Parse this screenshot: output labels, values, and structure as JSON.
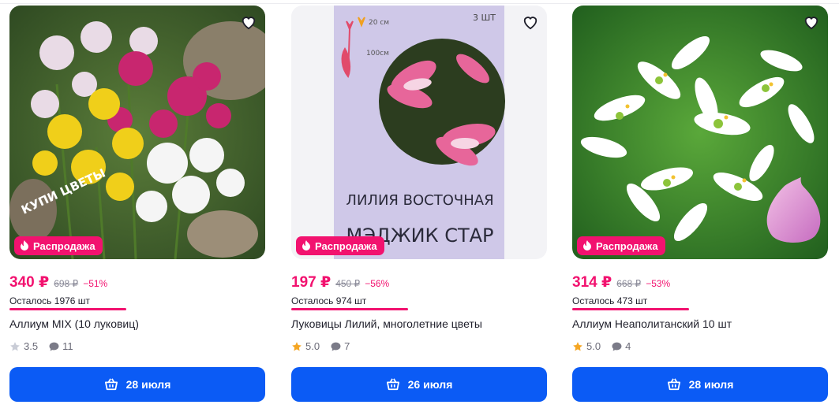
{
  "products": [
    {
      "badge": "Распродажа",
      "price": "340 ₽",
      "old_price": "698 ₽",
      "discount": "−51%",
      "stock_left": "Осталось 1976 шт",
      "title": "Аллиум MIX (10 луковиц)",
      "rating": "3.5",
      "reviews": "11",
      "delivery": "28 июля",
      "image_text": "КУПИ ЦВЕТЫ"
    },
    {
      "badge": "Распродажа",
      "price": "197 ₽",
      "old_price": "450 ₽",
      "discount": "−56%",
      "stock_left": "Осталось 974 шт",
      "title": "Луковицы Лилий, многолетние цветы",
      "rating": "5.0",
      "reviews": "7",
      "delivery": "26 июля",
      "image_text": {
        "count": "3 ШТ",
        "height1": "20 см",
        "height2": "100см",
        "line1": "ЛИЛИЯ ВОСТОЧНАЯ",
        "line2": "МЭДЖИК СТАР"
      }
    },
    {
      "badge": "Распродажа",
      "price": "314 ₽",
      "old_price": "668 ₽",
      "discount": "−53%",
      "stock_left": "Осталось 473 шт",
      "title": "Аллиум Неаполитанский 10 шт",
      "rating": "5.0",
      "reviews": "4",
      "delivery": "28 июля"
    }
  ],
  "colors": {
    "accent_pink": "#f2126f",
    "button_blue": "#0b5bf5",
    "star_gold": "#f5a623",
    "star_grey": "#c9ccd6"
  },
  "icons": [
    "heart-icon",
    "fire-icon",
    "star-icon",
    "comment-icon",
    "basket-icon"
  ]
}
